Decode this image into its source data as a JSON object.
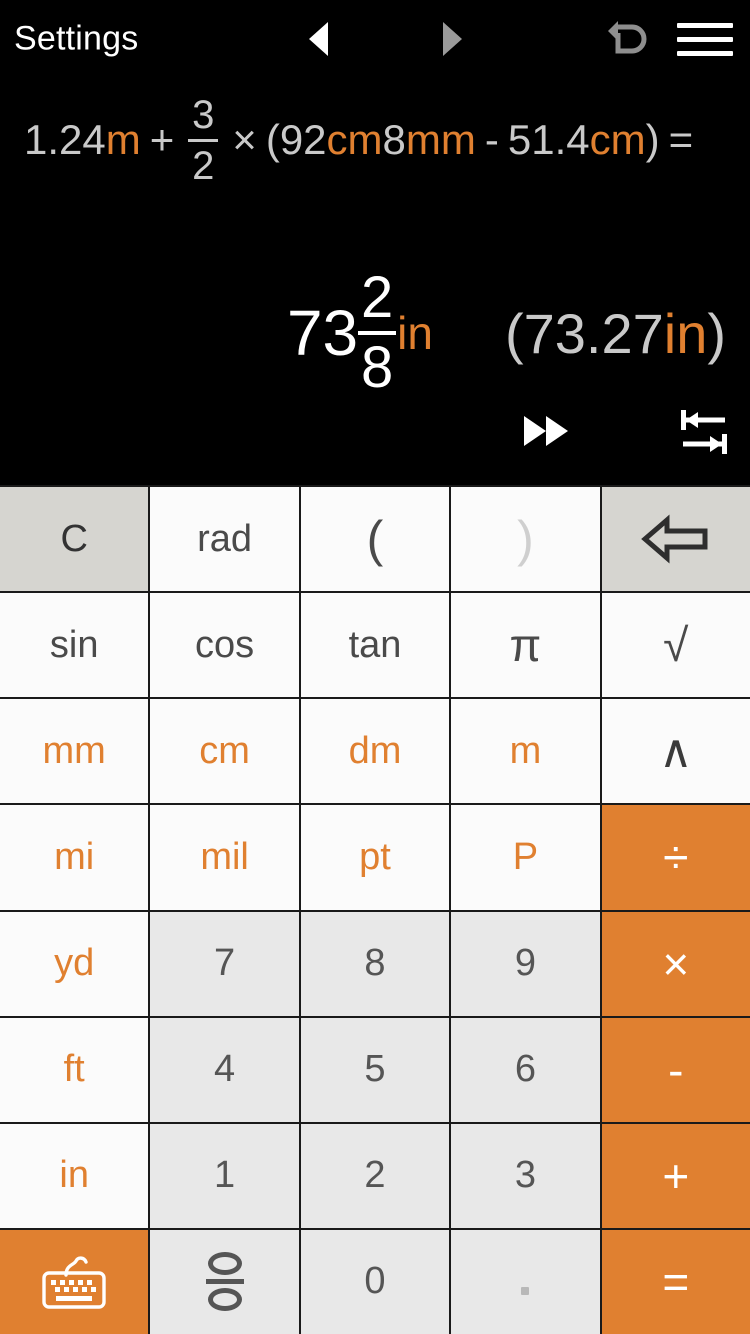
{
  "header": {
    "title": "Settings",
    "nav_prev": "prev-arrow",
    "nav_next": "next-arrow",
    "undo": "undo-icon",
    "menu": "hamburger-menu-icon"
  },
  "display": {
    "expression": {
      "full_text": "1.24m + 3/2 × (92cm8mm - 51.4cm) =",
      "tokens": [
        {
          "text": "1.24",
          "kind": "number"
        },
        {
          "text": "m",
          "kind": "unit"
        },
        {
          "text": "+",
          "kind": "operator"
        },
        {
          "text": "3",
          "kind": "fraction-numerator"
        },
        {
          "text": "2",
          "kind": "fraction-denominator"
        },
        {
          "text": "×",
          "kind": "operator"
        },
        {
          "text": "(",
          "kind": "paren"
        },
        {
          "text": "92",
          "kind": "number"
        },
        {
          "text": "cm",
          "kind": "unit"
        },
        {
          "text": "8",
          "kind": "number"
        },
        {
          "text": "mm",
          "kind": "unit"
        },
        {
          "text": "-",
          "kind": "operator"
        },
        {
          "text": "51.4",
          "kind": "number"
        },
        {
          "text": "cm",
          "kind": "unit"
        },
        {
          "text": ")",
          "kind": "paren"
        },
        {
          "text": "=",
          "kind": "operator"
        }
      ],
      "p1": "1.24",
      "u1": "m",
      "plus": "+",
      "fnum": "3",
      "fden": "2",
      "times": "×",
      "open": "(",
      "p2": "92",
      "u2": "cm",
      "p3": "8",
      "u3": "mm",
      "minus": "-",
      "p4": "51.4",
      "u4": "cm",
      "close": ")",
      "equals": "="
    },
    "result": {
      "whole": "73",
      "numerator": "2",
      "denominator": "8",
      "unit": "in",
      "approx_open": "(",
      "approx_value": "73.27",
      "approx_unit": "in",
      "approx_close": ")",
      "full_text": "73 2/8 in (73.27in)"
    },
    "tools": {
      "fast_forward": "fast-forward-icon",
      "fit_width": "fit-width-icon"
    }
  },
  "colors": {
    "accent_orange": "#e08030",
    "display_bg": "#000000",
    "key_white": "#fbfbfb",
    "key_gray": "#d6d5d0",
    "key_numpad": "#e8e8e8",
    "text_dark": "#4a4a4a",
    "text_light": "#c9c9c9"
  },
  "keypad": {
    "rows": [
      [
        {
          "label": "C",
          "style": "gray",
          "name": "clear-key"
        },
        {
          "label": "rad",
          "style": "white",
          "name": "rad-key"
        },
        {
          "label": "(",
          "style": "white",
          "name": "open-paren-key"
        },
        {
          "label": ")",
          "style": "dimmed",
          "name": "close-paren-key"
        },
        {
          "label": "",
          "style": "gray",
          "name": "backspace-key",
          "icon": "backspace-arrow-icon"
        }
      ],
      [
        {
          "label": "sin",
          "style": "white",
          "name": "sin-key"
        },
        {
          "label": "cos",
          "style": "white",
          "name": "cos-key"
        },
        {
          "label": "tan",
          "style": "white",
          "name": "tan-key"
        },
        {
          "label": "π",
          "style": "white",
          "name": "pi-key"
        },
        {
          "label": "√",
          "style": "white",
          "name": "sqrt-key"
        }
      ],
      [
        {
          "label": "mm",
          "style": "unit",
          "name": "mm-unit-key"
        },
        {
          "label": "cm",
          "style": "unit",
          "name": "cm-unit-key"
        },
        {
          "label": "dm",
          "style": "unit",
          "name": "dm-unit-key"
        },
        {
          "label": "m",
          "style": "unit",
          "name": "m-unit-key"
        },
        {
          "label": "∧",
          "style": "dark",
          "name": "power-key"
        }
      ],
      [
        {
          "label": "mi",
          "style": "unit",
          "name": "mi-unit-key"
        },
        {
          "label": "mil",
          "style": "unit",
          "name": "mil-unit-key"
        },
        {
          "label": "pt",
          "style": "unit",
          "name": "pt-unit-key"
        },
        {
          "label": "P",
          "style": "unit",
          "name": "pica-unit-key"
        },
        {
          "label": "÷",
          "style": "orange",
          "name": "divide-key"
        }
      ],
      [
        {
          "label": "yd",
          "style": "unit",
          "name": "yd-unit-key"
        },
        {
          "label": "7",
          "style": "numpad",
          "name": "digit-7-key"
        },
        {
          "label": "8",
          "style": "numpad",
          "name": "digit-8-key"
        },
        {
          "label": "9",
          "style": "numpad",
          "name": "digit-9-key"
        },
        {
          "label": "×",
          "style": "orange",
          "name": "multiply-key"
        }
      ],
      [
        {
          "label": "ft",
          "style": "unit",
          "name": "ft-unit-key"
        },
        {
          "label": "4",
          "style": "numpad",
          "name": "digit-4-key"
        },
        {
          "label": "5",
          "style": "numpad",
          "name": "digit-5-key"
        },
        {
          "label": "6",
          "style": "numpad",
          "name": "digit-6-key"
        },
        {
          "label": "-",
          "style": "orange",
          "name": "minus-key"
        }
      ],
      [
        {
          "label": "in",
          "style": "unit",
          "name": "in-unit-key"
        },
        {
          "label": "1",
          "style": "numpad",
          "name": "digit-1-key"
        },
        {
          "label": "2",
          "style": "numpad",
          "name": "digit-2-key"
        },
        {
          "label": "3",
          "style": "numpad",
          "name": "digit-3-key"
        },
        {
          "label": "+",
          "style": "orange",
          "name": "plus-key"
        }
      ],
      [
        {
          "label": "",
          "style": "orange",
          "name": "keyboard-toggle-key",
          "icon": "keyboard-icon"
        },
        {
          "label": "",
          "style": "numpad",
          "name": "fraction-template-key",
          "icon": "fraction-glyph-icon"
        },
        {
          "label": "0",
          "style": "numpad",
          "name": "digit-0-key"
        },
        {
          "label": "",
          "style": "numpad",
          "name": "decimal-point-key",
          "icon": "decimal-dot-icon"
        },
        {
          "label": "=",
          "style": "orange",
          "name": "equals-key"
        }
      ]
    ]
  }
}
